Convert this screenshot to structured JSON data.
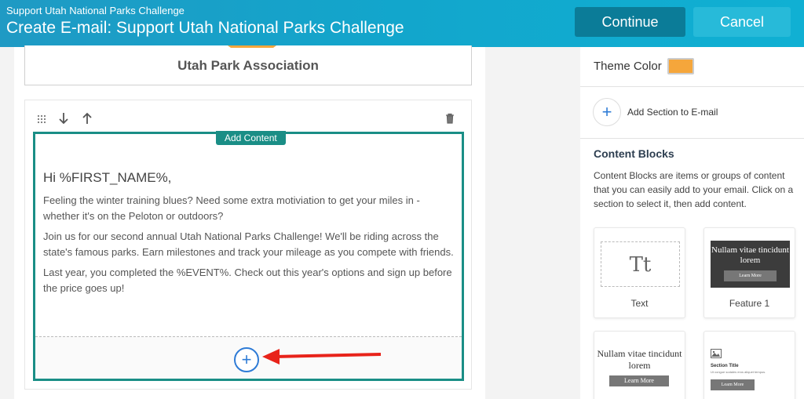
{
  "header": {
    "subtitle": "Support Utah National Parks Challenge",
    "title": "Create E-mail: Support Utah National Parks Challenge",
    "continue_label": "Continue",
    "cancel_label": "Cancel"
  },
  "editor": {
    "org_name": "Utah Park Association",
    "toolbar_icons": [
      "drag-handle-icon",
      "arrow-down-icon",
      "arrow-up-icon",
      "trash-icon"
    ],
    "add_content_label": "Add Content",
    "greeting": "Hi %FIRST_NAME%,",
    "paragraphs": [
      "Feeling the winter training blues? Need some extra motiviation to get your miles in - whether it's on the Peloton or outdoors?",
      "Join us for our second annual Utah National Parks Challenge! We'll be riding across the state's famous parks. Earn milestones and track your mileage as you compete with friends.",
      "Last year, you completed the %EVENT%. Check out this year's options and sign up before the price goes up!"
    ],
    "add_icon": "plus-icon"
  },
  "panel": {
    "theme_color_label": "Theme Color",
    "theme_color": "#f5a63b",
    "add_section_label": "Add Section to E-mail",
    "content_blocks_title": "Content Blocks",
    "content_blocks_desc": "Content Blocks are items or groups of content that you can easily add to your email. Click on a section to select it, then add content.",
    "blocks": [
      {
        "label": "Text",
        "preview": "Tt"
      },
      {
        "label": "Feature 1",
        "heading": "Nullam vitae tincidunt lorem",
        "button": "Learn More"
      },
      {
        "label": "",
        "heading": "Nullam vitae tincidunt lorem",
        "button": "Learn More"
      },
      {
        "label": "",
        "heading": "Section Title",
        "sub": "Ut congue sodales eros aliquet tempus.",
        "button": "Learn More"
      }
    ]
  },
  "colors": {
    "header_start": "#1f9ac4",
    "accent_teal": "#1a8e86",
    "plus_blue": "#2e7bd6",
    "annotation_arrow": "#e8231a"
  }
}
